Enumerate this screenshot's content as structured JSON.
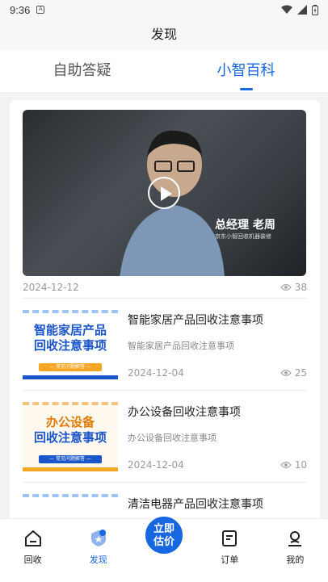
{
  "status_bar": {
    "time": "9:36"
  },
  "header": {
    "title": "发现"
  },
  "tabs": [
    {
      "label": "自助答疑",
      "active": false
    },
    {
      "label": "小智百科",
      "active": true
    }
  ],
  "featured": {
    "caption_main": "总经理 老周",
    "caption_sub": "京东小智回收机器装修",
    "date": "2024-12-12",
    "views": "38"
  },
  "articles": [
    {
      "thumb_line1": "智能家居产品",
      "thumb_line2": "回收注意事项",
      "thumb_tag": "— 常见问题解答 —",
      "title": "智能家居产品回收注意事项",
      "subtitle": "智能家居产品回收注意事项",
      "date": "2024-12-04",
      "views": "25"
    },
    {
      "thumb_line1": "办公设备",
      "thumb_line2": "回收注意事项",
      "thumb_tag": "— 常见问题解答 —",
      "title": "办公设备回收注意事项",
      "subtitle": "办公设备回收注意事项",
      "date": "2024-12-04",
      "views": "10"
    },
    {
      "thumb_line1": "",
      "thumb_line2": "",
      "thumb_tag": "",
      "title": "清洁电器产品回收注意事项",
      "subtitle": "",
      "date": "",
      "views": ""
    }
  ],
  "bottom_nav": {
    "recycle": "回收",
    "discover": "发现",
    "estimate_line1": "立即",
    "estimate_line2": "估价",
    "orders": "订单",
    "mine": "我的"
  },
  "colors": {
    "accent": "#1767e0"
  }
}
